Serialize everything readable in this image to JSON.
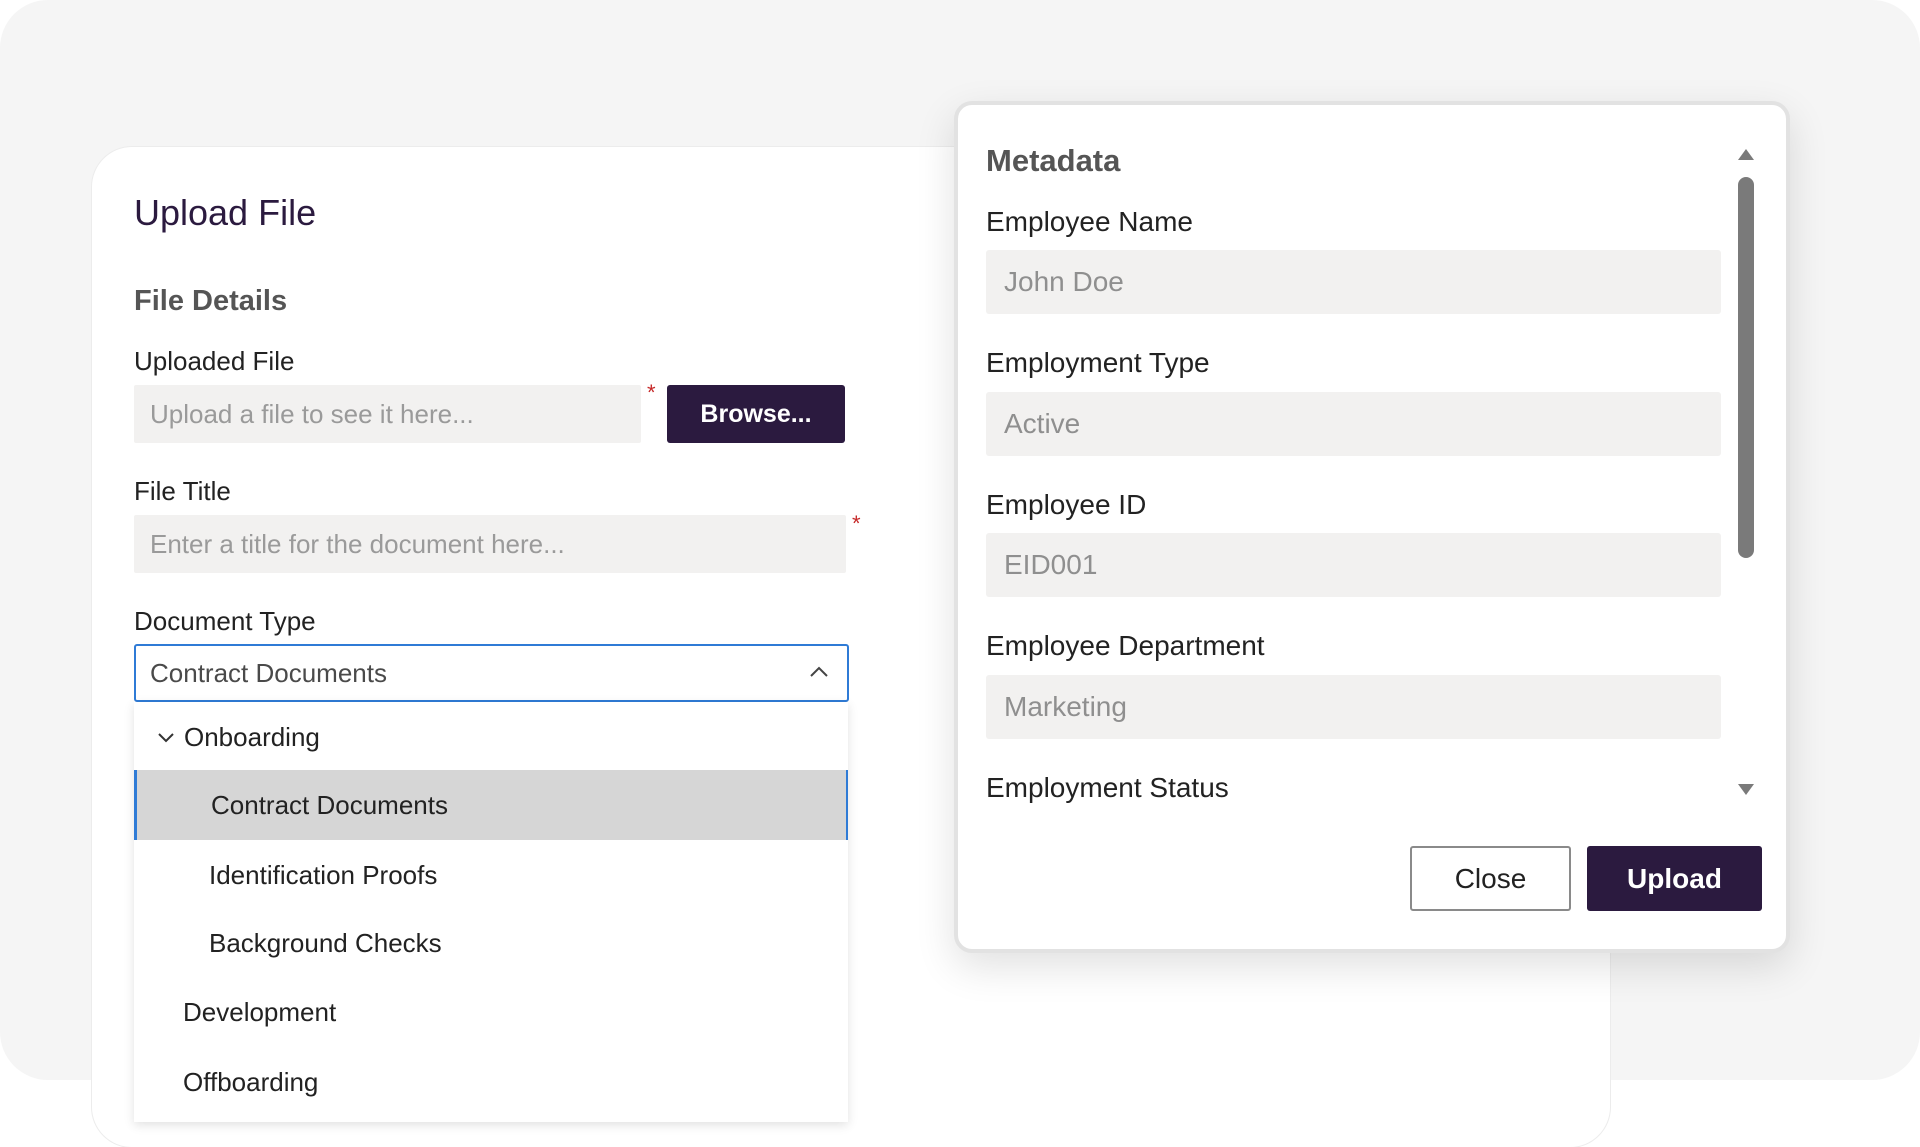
{
  "upload_form": {
    "title": "Upload File",
    "section_title": "File Details",
    "uploaded_file": {
      "label": "Uploaded File",
      "placeholder": "Upload a file to see it here...",
      "required_mark": "*",
      "browse_label": "Browse..."
    },
    "file_title": {
      "label": "File Title",
      "placeholder": "Enter a title for the document here...",
      "required_mark": "*"
    },
    "document_type": {
      "label": "Document Type",
      "selected_value": "Contract Documents",
      "options": [
        {
          "label": "Onboarding",
          "level": 0,
          "expanded": true
        },
        {
          "label": "Contract Documents",
          "level": 1,
          "selected": true
        },
        {
          "label": "Identification Proofs",
          "level": 1
        },
        {
          "label": "Background Checks",
          "level": 1
        },
        {
          "label": "Development",
          "level": 0
        },
        {
          "label": "Offboarding",
          "level": 0
        }
      ]
    }
  },
  "metadata": {
    "title": "Metadata",
    "fields": [
      {
        "label": "Employee Name",
        "value": "John Doe"
      },
      {
        "label": "Employment Type",
        "value": "Active"
      },
      {
        "label": "Employee ID",
        "value": "EID001"
      },
      {
        "label": "Employee Department",
        "value": "Marketing"
      },
      {
        "label": "Employment Status",
        "value": ""
      }
    ],
    "close_label": "Close",
    "upload_label": "Upload"
  },
  "colors": {
    "brand": "#2b1a3f",
    "focus": "#2f7bd6",
    "required": "#c62828"
  }
}
